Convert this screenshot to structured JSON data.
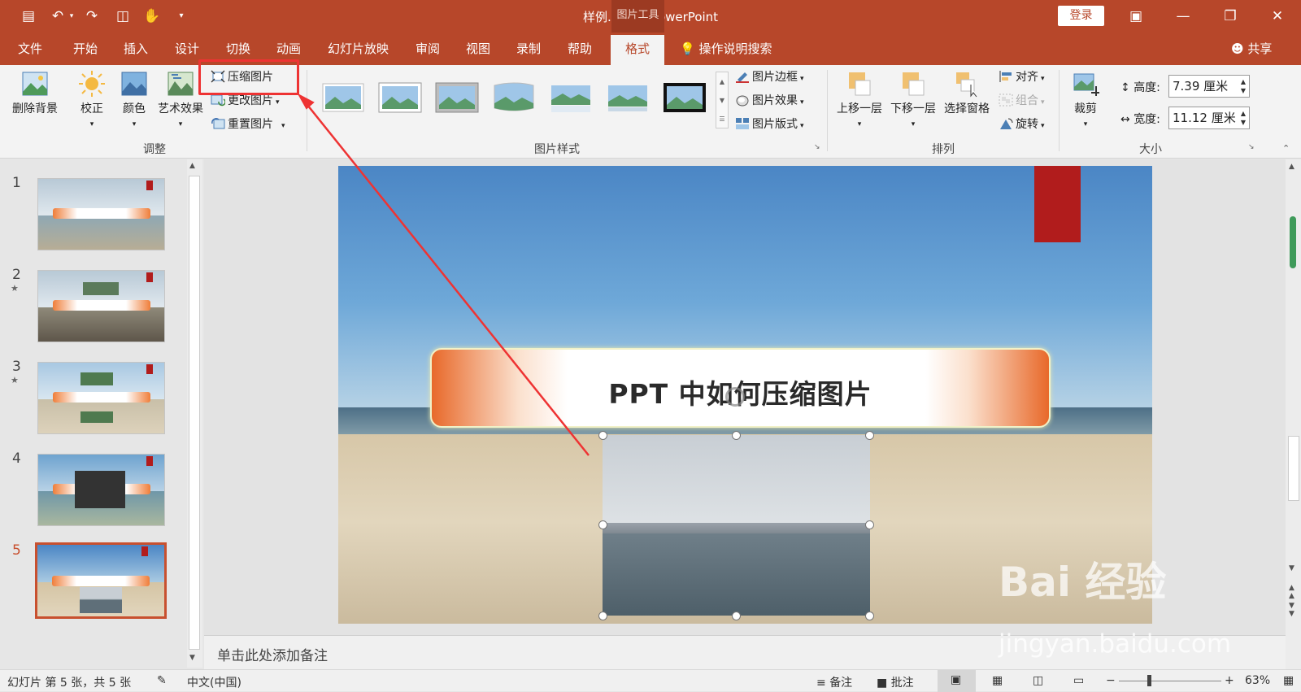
{
  "window": {
    "doc_title": "样例.pptx  -  PowerPoint",
    "context_tool": "图片工具",
    "login_label": "登录"
  },
  "menu": {
    "tabs": [
      "文件",
      "开始",
      "插入",
      "设计",
      "切换",
      "动画",
      "幻灯片放映",
      "审阅",
      "视图",
      "录制",
      "帮助",
      "格式"
    ],
    "active_tab": "格式",
    "tell_me": "操作说明搜索",
    "share": "共享"
  },
  "ribbon": {
    "adjust": {
      "remove_bg": "删除背景",
      "corrections": "校正",
      "color": "颜色",
      "artistic": "艺术效果",
      "compress": "压缩图片",
      "change": "更改图片",
      "reset": "重置图片",
      "group_label": "调整"
    },
    "styles": {
      "border": "图片边框",
      "effects": "图片效果",
      "layout": "图片版式",
      "group_label": "图片样式"
    },
    "arrange": {
      "bring_forward": "上移一层",
      "send_backward": "下移一层",
      "selection_pane": "选择窗格",
      "align": "对齐",
      "group": "组合",
      "rotate": "旋转",
      "group_label": "排列"
    },
    "size": {
      "crop": "裁剪",
      "height_label": "高度:",
      "height_value": "7.39 厘米",
      "width_label": "宽度:",
      "width_value": "11.12 厘米",
      "group_label": "大小"
    }
  },
  "slides": [
    {
      "num": "1",
      "star": ""
    },
    {
      "num": "2",
      "star": "★"
    },
    {
      "num": "3",
      "star": "★"
    },
    {
      "num": "4",
      "star": ""
    },
    {
      "num": "5",
      "star": ""
    }
  ],
  "current_slide": {
    "title": "PPT 中如何压缩图片"
  },
  "notes_placeholder": "单击此处添加备注",
  "status": {
    "slide_info": "幻灯片 第 5 张，共 5 张",
    "language": "中文(中国)",
    "notes": "备注",
    "comments": "批注",
    "zoom": "63%"
  },
  "watermark": {
    "brand": "Bai 经验",
    "url": "jingyan.baidu.com"
  },
  "colors": {
    "accent": "#b7472a",
    "highlight": "#ee3333"
  }
}
